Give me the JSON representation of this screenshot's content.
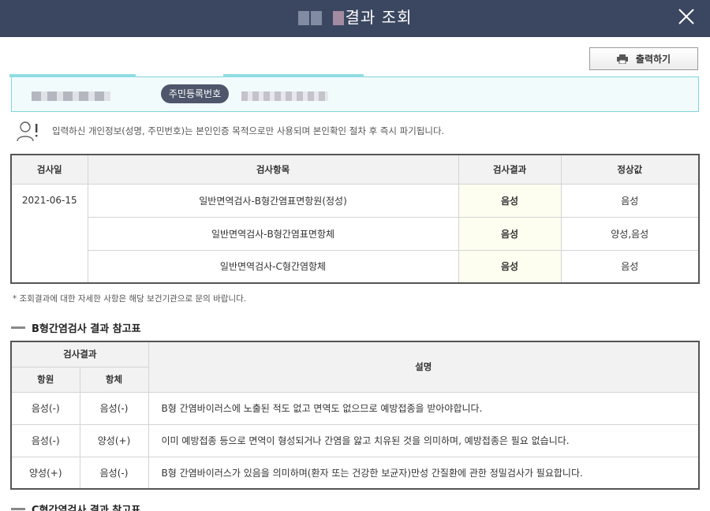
{
  "header": {
    "title_suffix": "결과 조회"
  },
  "toolbar": {
    "print_label": "출력하기"
  },
  "patient": {
    "id_label": "주민등록번호"
  },
  "privacy_notice": "입력하신 개인정보(성명, 주민번호)는 본인인증 목적으로만 사용되며 본인확인 절차 후 즉시 파기됩니다.",
  "results": {
    "columns": [
      "검사일",
      "검사항목",
      "검사결과",
      "정상값"
    ],
    "date": "2021-06-15",
    "rows": [
      {
        "item": "일반면역검사-B형간염표면항원(정성)",
        "result": "음성",
        "normal": "음성"
      },
      {
        "item": "일반면역검사-B형간염표면항체",
        "result": "음성",
        "normal": "양성,음성"
      },
      {
        "item": "일반면역검사-C형간염항체",
        "result": "음성",
        "normal": "음성"
      }
    ]
  },
  "note": "* 조회결과에 대한 자세한 사항은 해당 보건기관으로 문의 바랍니다.",
  "reference_b": {
    "title": "B형간염검사 결과 참고표",
    "group_header": "검사결과",
    "antigen_header": "항원",
    "antibody_header": "항체",
    "desc_header": "설명",
    "rows": [
      {
        "antigen": "음성(-)",
        "antibody": "음성(-)",
        "desc": "B형 간염바이러스에 노출된 적도 없고 면역도 없으므로 예방접종을 받아야합니다."
      },
      {
        "antigen": "음성(-)",
        "antibody": "양성(+)",
        "desc": "이미 예방접종 등으로 면역이 형성되거나 간염을 앓고 치유된 것을 의미하며, 예방접종은 필요 없습니다."
      },
      {
        "antigen": "양성(+)",
        "antibody": "음성(-)",
        "desc": "B형 간염바이러스가 있음을 의미하며(환자 또는 건강한 보균자)만성 간질환에 관한 정밀검사가 필요합니다."
      }
    ]
  },
  "reference_c": {
    "title": "C형간염검사 결과 참고표"
  },
  "colors": {
    "header": "#3b4660",
    "accent": "#7ed6de",
    "badge": "#4d566b"
  },
  "icons": {
    "close": "close-icon",
    "print": "printer-icon",
    "privacy": "person-alert-icon"
  }
}
